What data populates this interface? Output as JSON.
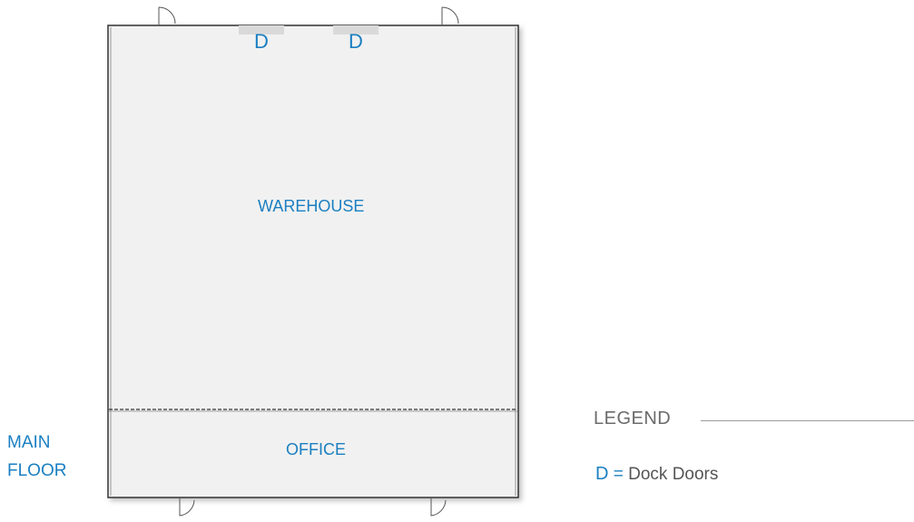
{
  "floor_plan": {
    "floor_label_lines": [
      "MAIN",
      "FLOOR"
    ],
    "rooms": {
      "warehouse": "WAREHOUSE",
      "office": "OFFICE"
    },
    "dock_doors": [
      "D",
      "D"
    ]
  },
  "legend": {
    "title": "LEGEND",
    "key": "D",
    "equals": "=",
    "meaning": "Dock Doors"
  },
  "colors": {
    "label_blue": "#1a7fc1",
    "room_fill": "#f1f1f1",
    "wall": "#333333",
    "dock_marker": "#d9d9d9"
  }
}
